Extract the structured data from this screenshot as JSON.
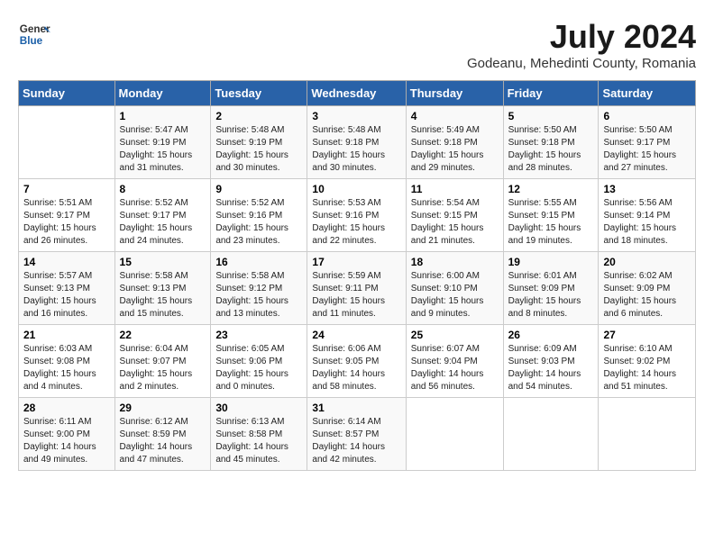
{
  "logo": {
    "general": "General",
    "blue": "Blue"
  },
  "title": "July 2024",
  "location": "Godeanu, Mehedinti County, Romania",
  "days_of_week": [
    "Sunday",
    "Monday",
    "Tuesday",
    "Wednesday",
    "Thursday",
    "Friday",
    "Saturday"
  ],
  "weeks": [
    [
      {
        "day": "",
        "info": ""
      },
      {
        "day": "1",
        "info": "Sunrise: 5:47 AM\nSunset: 9:19 PM\nDaylight: 15 hours\nand 31 minutes."
      },
      {
        "day": "2",
        "info": "Sunrise: 5:48 AM\nSunset: 9:19 PM\nDaylight: 15 hours\nand 30 minutes."
      },
      {
        "day": "3",
        "info": "Sunrise: 5:48 AM\nSunset: 9:18 PM\nDaylight: 15 hours\nand 30 minutes."
      },
      {
        "day": "4",
        "info": "Sunrise: 5:49 AM\nSunset: 9:18 PM\nDaylight: 15 hours\nand 29 minutes."
      },
      {
        "day": "5",
        "info": "Sunrise: 5:50 AM\nSunset: 9:18 PM\nDaylight: 15 hours\nand 28 minutes."
      },
      {
        "day": "6",
        "info": "Sunrise: 5:50 AM\nSunset: 9:17 PM\nDaylight: 15 hours\nand 27 minutes."
      }
    ],
    [
      {
        "day": "7",
        "info": "Sunrise: 5:51 AM\nSunset: 9:17 PM\nDaylight: 15 hours\nand 26 minutes."
      },
      {
        "day": "8",
        "info": "Sunrise: 5:52 AM\nSunset: 9:17 PM\nDaylight: 15 hours\nand 24 minutes."
      },
      {
        "day": "9",
        "info": "Sunrise: 5:52 AM\nSunset: 9:16 PM\nDaylight: 15 hours\nand 23 minutes."
      },
      {
        "day": "10",
        "info": "Sunrise: 5:53 AM\nSunset: 9:16 PM\nDaylight: 15 hours\nand 22 minutes."
      },
      {
        "day": "11",
        "info": "Sunrise: 5:54 AM\nSunset: 9:15 PM\nDaylight: 15 hours\nand 21 minutes."
      },
      {
        "day": "12",
        "info": "Sunrise: 5:55 AM\nSunset: 9:15 PM\nDaylight: 15 hours\nand 19 minutes."
      },
      {
        "day": "13",
        "info": "Sunrise: 5:56 AM\nSunset: 9:14 PM\nDaylight: 15 hours\nand 18 minutes."
      }
    ],
    [
      {
        "day": "14",
        "info": "Sunrise: 5:57 AM\nSunset: 9:13 PM\nDaylight: 15 hours\nand 16 minutes."
      },
      {
        "day": "15",
        "info": "Sunrise: 5:58 AM\nSunset: 9:13 PM\nDaylight: 15 hours\nand 15 minutes."
      },
      {
        "day": "16",
        "info": "Sunrise: 5:58 AM\nSunset: 9:12 PM\nDaylight: 15 hours\nand 13 minutes."
      },
      {
        "day": "17",
        "info": "Sunrise: 5:59 AM\nSunset: 9:11 PM\nDaylight: 15 hours\nand 11 minutes."
      },
      {
        "day": "18",
        "info": "Sunrise: 6:00 AM\nSunset: 9:10 PM\nDaylight: 15 hours\nand 9 minutes."
      },
      {
        "day": "19",
        "info": "Sunrise: 6:01 AM\nSunset: 9:09 PM\nDaylight: 15 hours\nand 8 minutes."
      },
      {
        "day": "20",
        "info": "Sunrise: 6:02 AM\nSunset: 9:09 PM\nDaylight: 15 hours\nand 6 minutes."
      }
    ],
    [
      {
        "day": "21",
        "info": "Sunrise: 6:03 AM\nSunset: 9:08 PM\nDaylight: 15 hours\nand 4 minutes."
      },
      {
        "day": "22",
        "info": "Sunrise: 6:04 AM\nSunset: 9:07 PM\nDaylight: 15 hours\nand 2 minutes."
      },
      {
        "day": "23",
        "info": "Sunrise: 6:05 AM\nSunset: 9:06 PM\nDaylight: 15 hours\nand 0 minutes."
      },
      {
        "day": "24",
        "info": "Sunrise: 6:06 AM\nSunset: 9:05 PM\nDaylight: 14 hours\nand 58 minutes."
      },
      {
        "day": "25",
        "info": "Sunrise: 6:07 AM\nSunset: 9:04 PM\nDaylight: 14 hours\nand 56 minutes."
      },
      {
        "day": "26",
        "info": "Sunrise: 6:09 AM\nSunset: 9:03 PM\nDaylight: 14 hours\nand 54 minutes."
      },
      {
        "day": "27",
        "info": "Sunrise: 6:10 AM\nSunset: 9:02 PM\nDaylight: 14 hours\nand 51 minutes."
      }
    ],
    [
      {
        "day": "28",
        "info": "Sunrise: 6:11 AM\nSunset: 9:00 PM\nDaylight: 14 hours\nand 49 minutes."
      },
      {
        "day": "29",
        "info": "Sunrise: 6:12 AM\nSunset: 8:59 PM\nDaylight: 14 hours\nand 47 minutes."
      },
      {
        "day": "30",
        "info": "Sunrise: 6:13 AM\nSunset: 8:58 PM\nDaylight: 14 hours\nand 45 minutes."
      },
      {
        "day": "31",
        "info": "Sunrise: 6:14 AM\nSunset: 8:57 PM\nDaylight: 14 hours\nand 42 minutes."
      },
      {
        "day": "",
        "info": ""
      },
      {
        "day": "",
        "info": ""
      },
      {
        "day": "",
        "info": ""
      }
    ]
  ]
}
